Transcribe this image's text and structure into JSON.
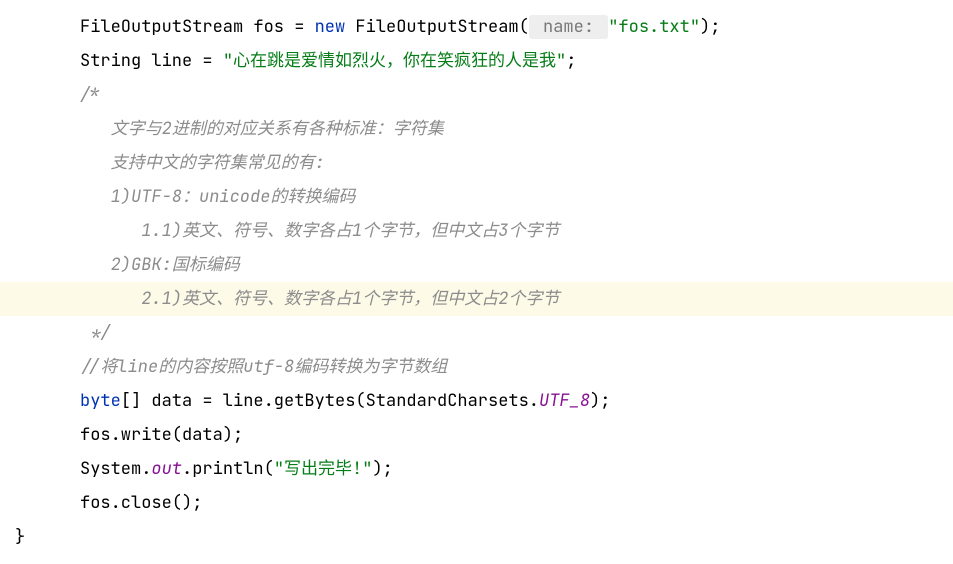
{
  "code": {
    "l1": {
      "t1": "FileOutputStream fos = ",
      "kw_new": "new",
      "t2": " FileOutputStream(",
      "hint": " name: ",
      "str": "\"fos.txt\"",
      "t3": ");"
    },
    "l2": {
      "t1": "String line = ",
      "str": "\"心在跳是爱情如烈火，你在笑疯狂的人是我\"",
      "t2": ";"
    },
    "l3": {
      "c": "/*"
    },
    "l4": {
      "c": "   文字与2进制的对应关系有各种标准：字符集"
    },
    "l5": {
      "c": "   支持中文的字符集常见的有:"
    },
    "l6": {
      "c": "   1)UTF-8：unicode的转换编码"
    },
    "l7": {
      "c": "      1.1)英文、符号、数字各占1个字节，但中文占3个字节"
    },
    "l8": {
      "c": "   2)GBK:国标编码"
    },
    "l9": {
      "c": "      2.1)英文、符号、数字各占1个字节，但中文占2个字节"
    },
    "l10": {
      "c": " */"
    },
    "l11": {
      "c": "//将line的内容按照utf-8编码转换为字节数组"
    },
    "l12": {
      "kw": "byte",
      "t1": "[] data = line.getBytes(StandardCharsets.",
      "const": "UTF_8",
      "t2": ");"
    },
    "l13": {
      "t": "fos.write(data);"
    },
    "l14": {
      "t1": "System.",
      "out": "out",
      "t2": ".println(",
      "str": "\"写出完毕!\"",
      "t3": ");"
    },
    "l15": {
      "t": "fos.close();"
    },
    "l16": {
      "t": "}"
    }
  }
}
